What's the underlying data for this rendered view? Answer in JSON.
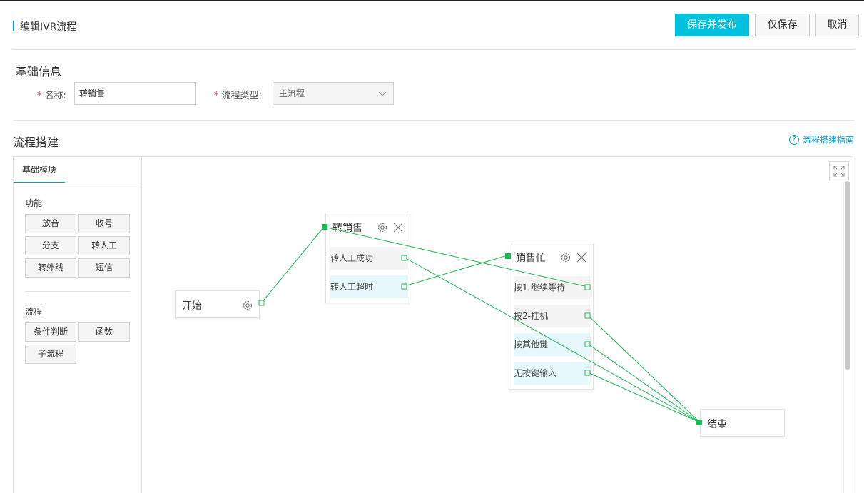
{
  "header": {
    "title": "编辑IVR流程",
    "publish_label": "保存并发布",
    "save_label": "仅保存",
    "cancel_label": "取消"
  },
  "basic_info": {
    "section_title": "基础信息",
    "name_label": "名称:",
    "name_value": "转销售",
    "type_label": "流程类型:",
    "type_value": "主流程"
  },
  "flow": {
    "section_title": "流程搭建",
    "guide_label": "流程搭建指南"
  },
  "palette": {
    "tab_label": "基础模块",
    "group_function": "功能",
    "function_items": [
      "放音",
      "收号",
      "分支",
      "转人工",
      "转外线",
      "短信"
    ],
    "group_flow": "流程",
    "flow_items": [
      "条件判断",
      "函数",
      "子流程"
    ]
  },
  "nodes": {
    "start": {
      "title": "开始"
    },
    "transfer_sales": {
      "title": "转销售",
      "branches": [
        "转人工成功",
        "转人工超时"
      ]
    },
    "sales_busy": {
      "title": "销售忙",
      "branches": [
        "按1-继续等待",
        "按2-挂机",
        "按其他键",
        "无按键输入"
      ]
    },
    "end": {
      "title": "结束"
    }
  },
  "colors": {
    "accent": "#00c1de",
    "link": "#00a2d4",
    "wire": "#1db954",
    "required": "#e3262e"
  }
}
